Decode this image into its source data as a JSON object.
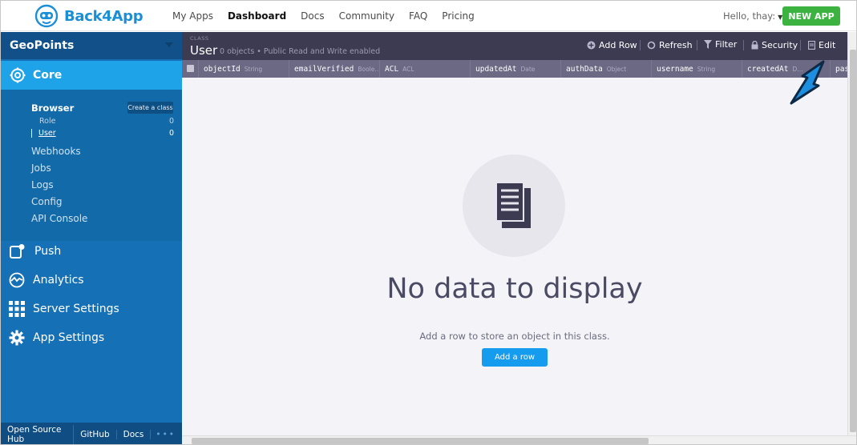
{
  "brand": {
    "name": "Back4App"
  },
  "topnav": {
    "links": [
      "My Apps",
      "Dashboard",
      "Docs",
      "Community",
      "FAQ",
      "Pricing"
    ],
    "greeting": "Hello, thay:",
    "new_app_label": "NEW APP"
  },
  "sidebar": {
    "app_name": "GeoPoints",
    "core_label": "Core",
    "browser_label": "Browser",
    "create_class_label": "Create a class",
    "classes": [
      {
        "name": "Role",
        "count": "0"
      },
      {
        "name": "User",
        "count": "0"
      }
    ],
    "core_items": [
      "Webhooks",
      "Jobs",
      "Logs",
      "Config",
      "API Console"
    ],
    "main_items": [
      "Push",
      "Analytics",
      "Server Settings",
      "App Settings"
    ],
    "footer_links": [
      "Open Source Hub",
      "GitHub",
      "Docs"
    ]
  },
  "toolbar": {
    "class_caption": "CLASS",
    "class_name": "User",
    "class_meta": "0 objects • Public Read and Write enabled",
    "add_row": "Add Row",
    "refresh": "Refresh",
    "filter": "Filter",
    "security": "Security",
    "edit": "Edit"
  },
  "table": {
    "columns": [
      {
        "name": "objectId",
        "type": "String"
      },
      {
        "name": "emailVerified",
        "type": "Boole…"
      },
      {
        "name": "ACL",
        "type": "ACL"
      },
      {
        "name": "updatedAt",
        "type": "Date"
      },
      {
        "name": "authData",
        "type": "Object"
      },
      {
        "name": "username",
        "type": "String"
      },
      {
        "name": "createdAt",
        "type": "D…"
      },
      {
        "name": "pas",
        "type": ""
      }
    ]
  },
  "empty": {
    "title": "No data to display",
    "hint": "Add a row to store an object in this class.",
    "button": "Add a row"
  }
}
